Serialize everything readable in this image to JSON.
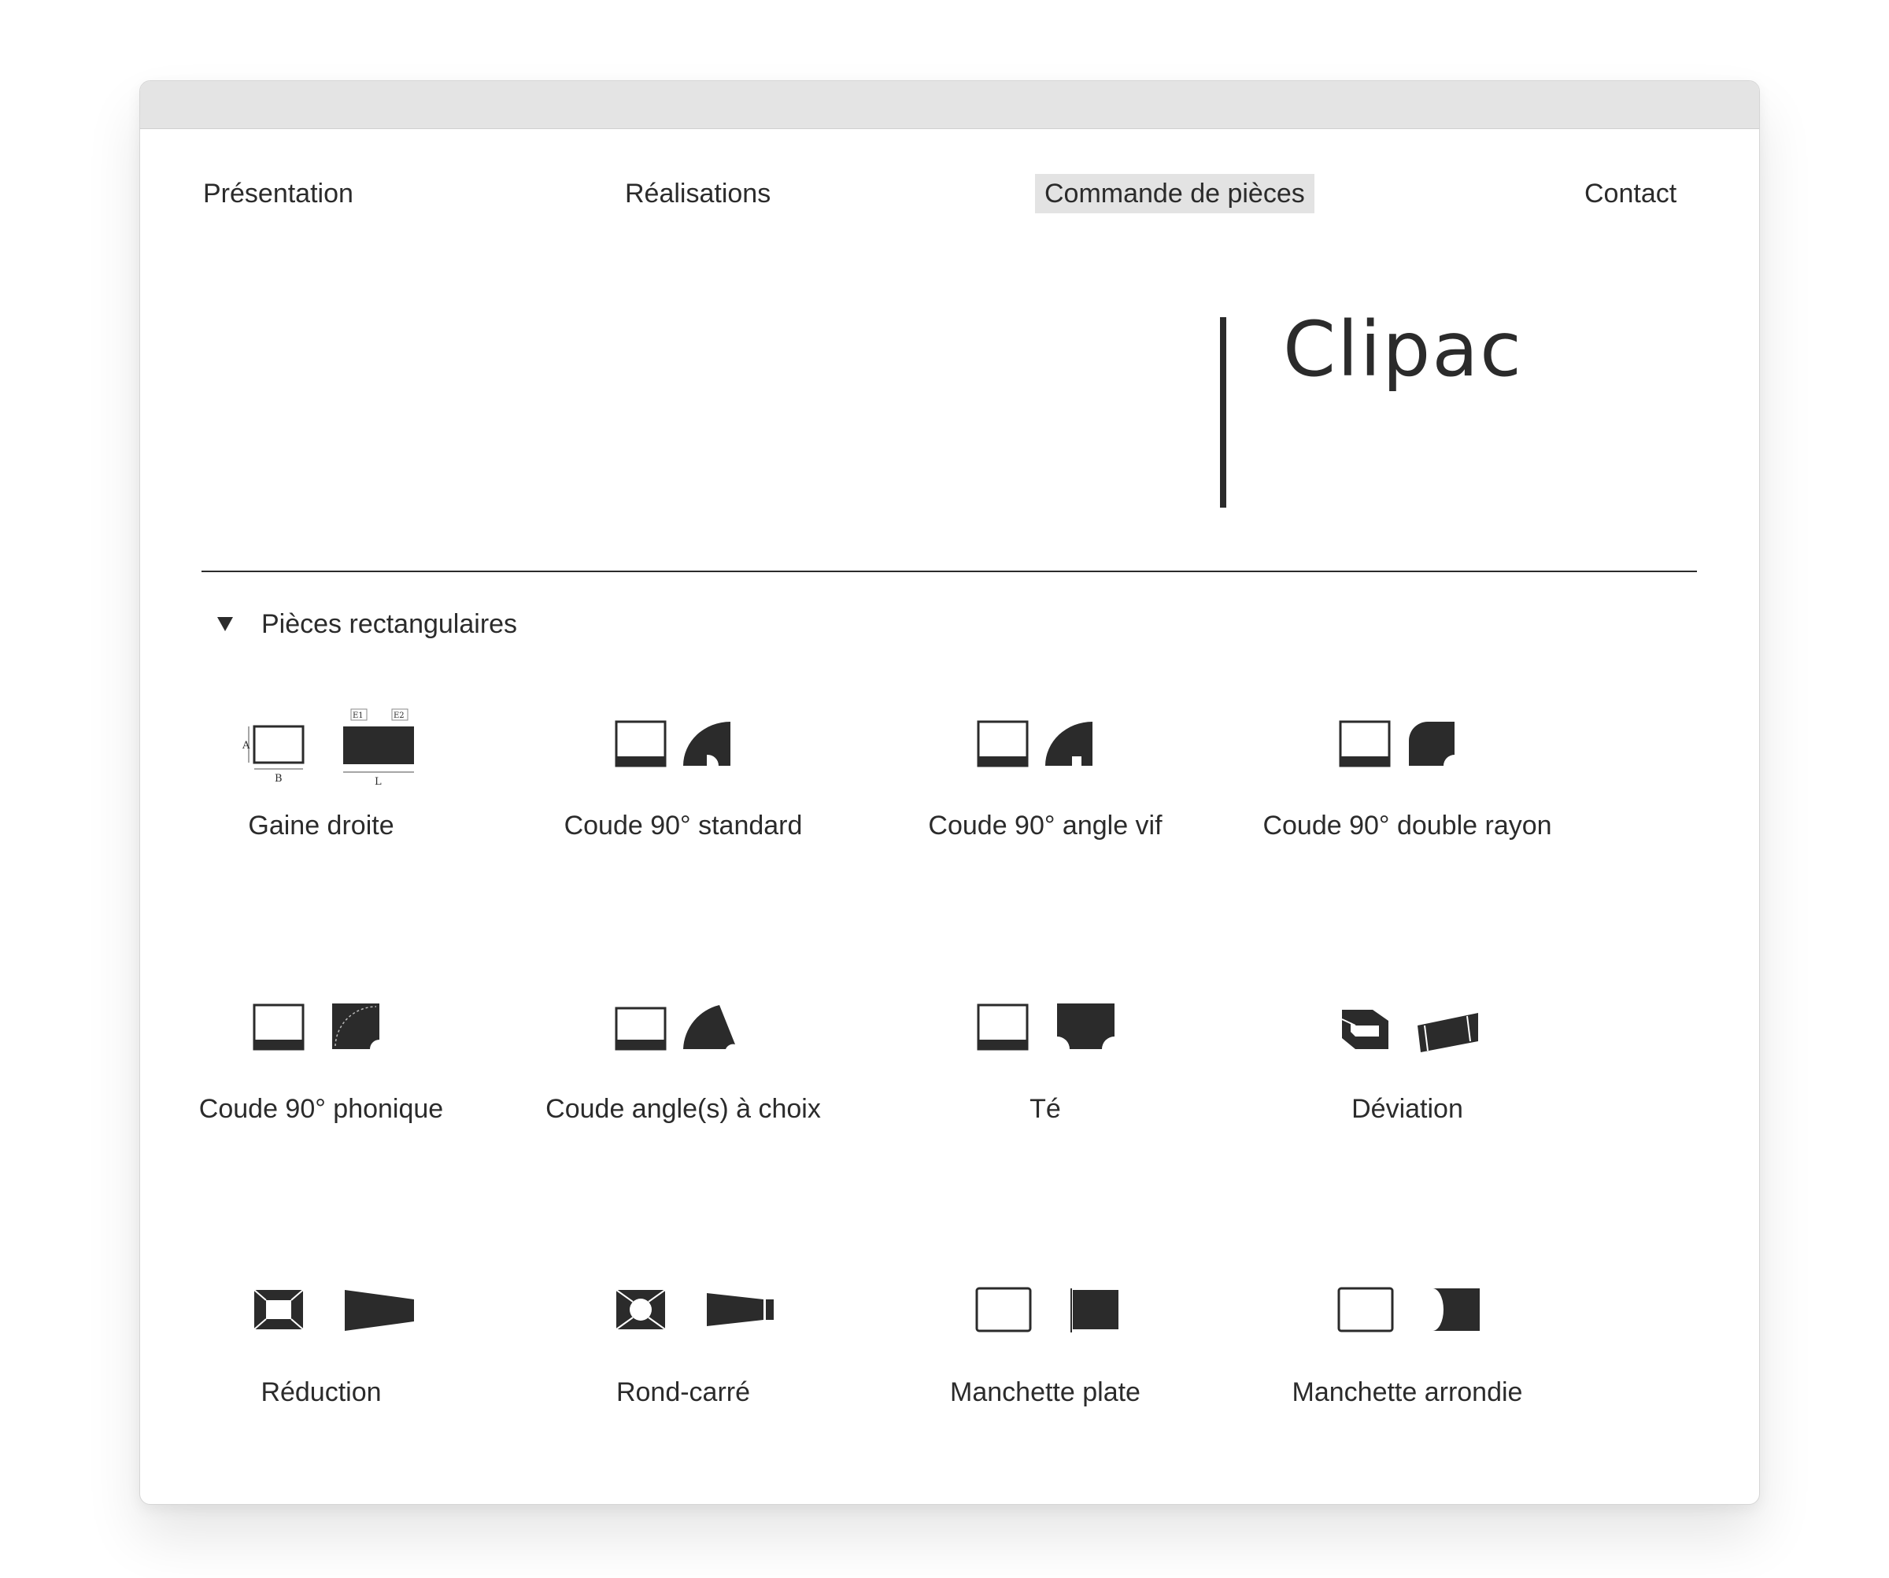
{
  "nav": {
    "items": [
      {
        "label": "Présentation"
      },
      {
        "label": "Réalisations"
      },
      {
        "label": "Commande de pièces",
        "active": true
      },
      {
        "label": "Contact"
      }
    ]
  },
  "brand": {
    "title": "Clipac"
  },
  "section": {
    "title": "Pièces rectangulaires",
    "expanded": true
  },
  "parts": [
    {
      "label": "Gaine droite",
      "icon": "gaine-droite-icon"
    },
    {
      "label": "Coude 90° standard",
      "icon": "coude-90-standard-icon"
    },
    {
      "label": "Coude 90° angle vif",
      "icon": "coude-90-angle-vif-icon"
    },
    {
      "label": "Coude 90° double rayon",
      "icon": "coude-90-double-rayon-icon"
    },
    {
      "label": "Coude 90° phonique",
      "icon": "coude-90-phonique-icon"
    },
    {
      "label": "Coude angle(s) à choix",
      "icon": "coude-angle-choix-icon"
    },
    {
      "label": "Té",
      "icon": "te-icon"
    },
    {
      "label": "Déviation",
      "icon": "deviation-icon"
    },
    {
      "label": "Réduction",
      "icon": "reduction-icon"
    },
    {
      "label": "Rond-carré",
      "icon": "rond-carre-icon"
    },
    {
      "label": "Manchette plate",
      "icon": "manchette-plate-icon"
    },
    {
      "label": "Manchette arrondie",
      "icon": "manchette-arrondie-icon"
    }
  ],
  "diagram_labels": {
    "a": "A",
    "b": "B",
    "l": "L",
    "e1": "E1",
    "e2": "E2"
  },
  "colors": {
    "ink": "#2b2b2b",
    "active_bg": "#e3e3e3",
    "titlebar": "#e4e4e4"
  }
}
